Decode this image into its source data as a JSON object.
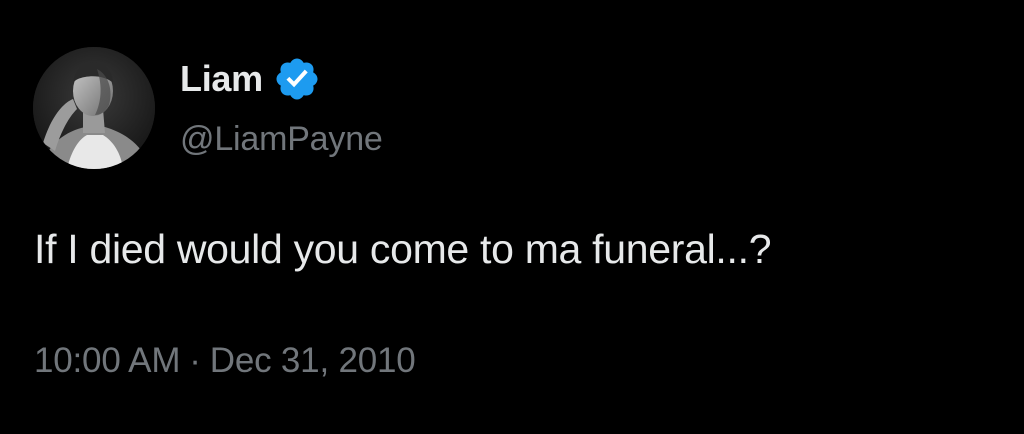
{
  "author": {
    "display_name": "Liam",
    "handle": "@LiamPayne",
    "verified_icon": "verified-badge-icon",
    "verified_color": "#1d9bf0"
  },
  "tweet": {
    "text": "If I died would you come to ma funeral...?",
    "time": "10:00 AM",
    "separator": "·",
    "date": "Dec 31, 2010"
  },
  "colors": {
    "background": "#000000",
    "primary_text": "#e7e9ea",
    "secondary_text": "#71767b"
  }
}
